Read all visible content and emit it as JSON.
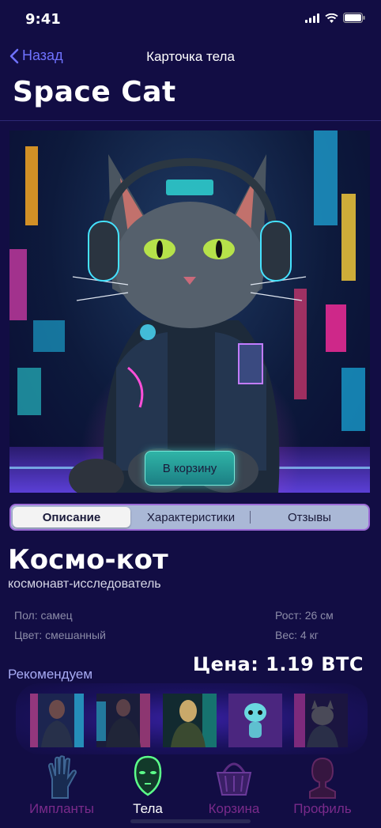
{
  "status_bar": {
    "time": "9:41"
  },
  "nav": {
    "back_label": "Назад",
    "title": "Карточка тела"
  },
  "page_title": "Space Cat",
  "hero": {
    "cart_button": "В корзину"
  },
  "segments": [
    {
      "label": "Описание",
      "active": true
    },
    {
      "label": "Характеристики",
      "active": false
    },
    {
      "label": "Отзывы",
      "active": false
    }
  ],
  "product": {
    "name": "Космо-кот",
    "subtitle": "космонавт-исследователь",
    "specs": {
      "sex": "Пол: самец",
      "color": "Цвет: смешанный",
      "height": "Рост: 26 см",
      "weight": "Вес: 4 кг"
    },
    "price": "Цена: 1.19 BTC"
  },
  "recommend": {
    "title": "Рекомендуем",
    "items": [
      "cyber-woman",
      "cyber-man",
      "android",
      "alien",
      "cyber-dog"
    ]
  },
  "tabbar": {
    "items": [
      {
        "label": "Импланты",
        "icon": "hand-icon",
        "active": false
      },
      {
        "label": "Тела",
        "icon": "head-icon",
        "active": true
      },
      {
        "label": "Корзина",
        "icon": "basket-icon",
        "active": false
      },
      {
        "label": "Профиль",
        "icon": "profile-icon",
        "active": false
      }
    ]
  },
  "colors": {
    "background": "#120d44",
    "accent": "#6f72ff",
    "tab_inactive": "#7a2a8a",
    "tab_active": "#ffffff"
  }
}
